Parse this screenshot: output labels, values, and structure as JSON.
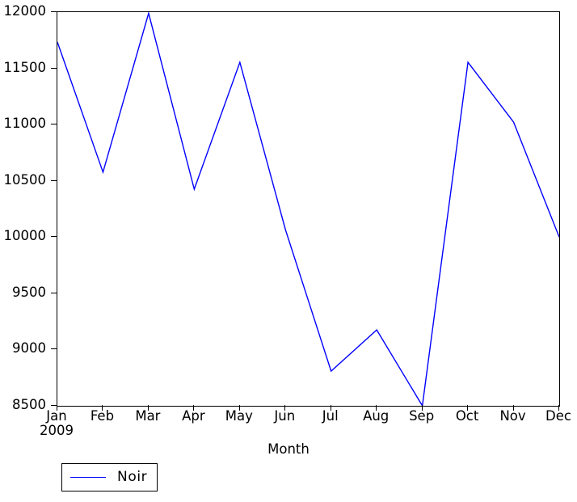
{
  "chart_data": {
    "type": "line",
    "title": "",
    "subtitle": "",
    "xlabel": "Month",
    "ylabel": "",
    "categories": [
      "Jan",
      "Feb",
      "Mar",
      "Apr",
      "May",
      "Jun",
      "Jul",
      "Aug",
      "Sep",
      "Oct",
      "Nov",
      "Dec"
    ],
    "x_tick_sublabels": [
      "2009",
      "",
      "",
      "",
      "",
      "",
      "",
      "",
      "",
      "",
      "",
      ""
    ],
    "series": [
      {
        "name": "Noir",
        "color": "#0000ff",
        "values": [
          11734,
          10577,
          11990,
          10426,
          11554,
          10065,
          8808,
          9175,
          8500,
          11554,
          11022,
          10000
        ]
      }
    ],
    "y_ticks": [
      8500,
      9000,
      9500,
      10000,
      10500,
      11000,
      11500,
      12000
    ],
    "y_tick_labels": [
      "8500",
      "9000",
      "9500",
      "10000",
      "10500",
      "11000",
      "11500",
      "12000"
    ],
    "ylim": [
      8500,
      12000
    ],
    "xlim": [
      0,
      11
    ],
    "grid": false,
    "legend": {
      "position": "below-left",
      "entries": [
        {
          "label": "Noir",
          "color": "#0000ff",
          "marker": "line"
        }
      ]
    },
    "axes_frame": true,
    "background_color": "#ffffff",
    "axis_color": "#000000"
  }
}
